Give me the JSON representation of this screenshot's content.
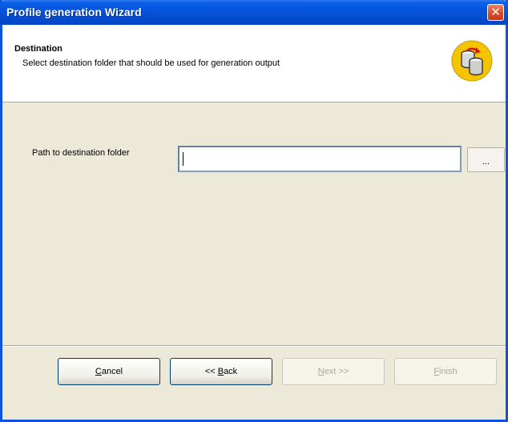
{
  "window": {
    "title": "Profile generation Wizard",
    "close_glyph": "✕"
  },
  "header": {
    "title": "Destination",
    "subtitle": "Select destination folder that should be used for generation output",
    "icon": "database-refresh-icon"
  },
  "form": {
    "path_label": "Path to destination folder",
    "path_value": "",
    "browse_label": "..."
  },
  "buttons": {
    "cancel": {
      "label": "Cancel",
      "accesskey": "C",
      "rest": "ancel"
    },
    "back": {
      "label": "<< Back",
      "prefix": "<< ",
      "accesskey": "B",
      "rest": "ack"
    },
    "next": {
      "label": "Next >>",
      "accesskey": "N",
      "rest": "ext >>",
      "enabled": false
    },
    "finish": {
      "label": "Finish",
      "accesskey": "F",
      "rest": "inish",
      "enabled": false
    }
  },
  "colors": {
    "titlebar": "#0553db",
    "dialog_bg": "#ece9d8",
    "icon_gold": "#f5c400"
  }
}
